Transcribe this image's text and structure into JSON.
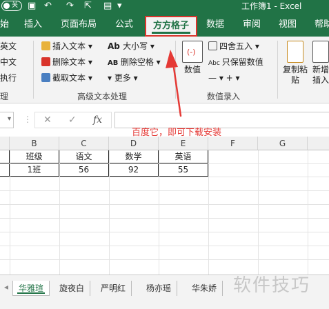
{
  "titlebar": {
    "autosave_label": "关",
    "document_title": "工作簿1  -  Excel"
  },
  "tabs": [
    {
      "label": "始"
    },
    {
      "label": "插入"
    },
    {
      "label": "页面布局"
    },
    {
      "label": "公式"
    },
    {
      "label": "方方格子"
    },
    {
      "label": "数据"
    },
    {
      "label": "审阅"
    },
    {
      "label": "视图"
    },
    {
      "label": "帮助"
    }
  ],
  "ribbon": {
    "left_items": [
      "英文",
      "中文",
      "执行"
    ],
    "text_group": {
      "insert_text": "插入文本",
      "delete_text": "删除文本",
      "extract_text": "截取文本",
      "case": "大小写",
      "delete_space": "删除空格",
      "more": "更多",
      "label": "高级文本处理"
    },
    "number_group": {
      "value_button": "数值",
      "round": "四舍五入",
      "keep_numbers": "只保留数值",
      "label": "数值录入"
    },
    "copy_paste": "复制粘贴",
    "add_insert": "新增插入",
    "first_group_label": "理"
  },
  "formula_bar": {
    "fx_label": "fx",
    "value": ""
  },
  "grid": {
    "columns": [
      "B",
      "C",
      "D",
      "E",
      "F",
      "G"
    ],
    "header_row": [
      "班级",
      "语文",
      "数学",
      "英语"
    ],
    "data_row": [
      "1班",
      "56",
      "92",
      "55"
    ]
  },
  "annotation": {
    "text": "百度它，即可下载安装",
    "color": "#e53935"
  },
  "sheets": [
    "华雅瑄",
    "旋夜白",
    "严明红",
    "杨亦瑶",
    "华朱娇"
  ],
  "watermark": "软件技巧",
  "colors": {
    "excel_green": "#217346",
    "highlight_red": "#d9342b"
  }
}
